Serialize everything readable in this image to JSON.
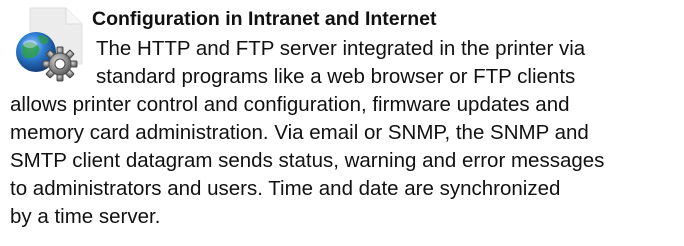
{
  "section": {
    "title": "Configuration in Intranet and Internet",
    "icon": "globe-with-gear-icon",
    "body_lines": [
      "The HTTP and FTP server integrated in the printer via",
      "standard programs like a web browser or FTP clients",
      "allows printer control and configuration, firmware updates and",
      "memory card administration. Via email or SNMP, the SNMP and",
      "SMTP client datagram sends status, warning and error messages",
      "to administrators and users. Time and date are synchronized",
      "by a time server."
    ]
  },
  "colors": {
    "text": "#111111",
    "globe_blue": "#1f5fa8",
    "gear_gray": "#6f6f6f",
    "page_background": "#e8e8e8"
  }
}
